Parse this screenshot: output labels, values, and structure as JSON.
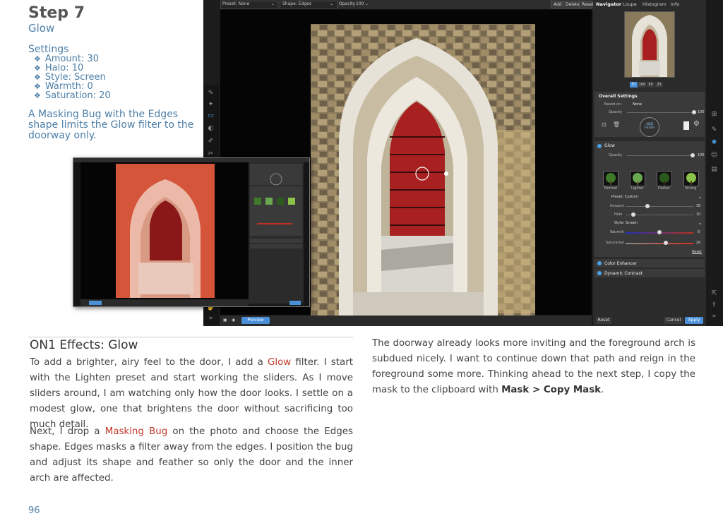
{
  "step": {
    "title": "Step 7",
    "subtitle": "Glow",
    "settings_heading": "Settings",
    "settings": [
      "Amount: 30",
      "Halo: 10",
      "Style: Screen",
      "Warmth: 0",
      "Saturation: 20"
    ],
    "caption": "A Masking Bug with the Edges shape limits the Glow filter to the doorway only."
  },
  "app": {
    "topbar": {
      "preset": "Preset: None",
      "shape": "Shape: Edges",
      "opacity_label": "Opacity",
      "opacity_value": "100",
      "add": "Add",
      "delete": "Delete",
      "reset": "Reset"
    },
    "bottombar": {
      "preview": "Preview"
    },
    "panel": {
      "tabs": [
        "Navigator",
        "Loupe",
        "Histogram",
        "Info"
      ],
      "zoom": [
        "Fit",
        "100",
        "50",
        "25"
      ],
      "overall_title": "Overall Settings",
      "based_on_label": "Based on:",
      "based_on_value": "None",
      "opacity_label": "Opacity",
      "opacity_value": "100",
      "add_filter": "ADD FILTER",
      "glow": {
        "title": "Glow",
        "opacity_label": "Opacity",
        "opacity_value": "100",
        "presets": [
          "Normal",
          "Lighter",
          "Darker",
          "Strong"
        ],
        "preset_label": "Preset: Custom",
        "amount_label": "Amount",
        "amount_value": "30",
        "amount_fraction": 0.3,
        "halo_label": "Halo",
        "halo_value": "10",
        "halo_fraction": 0.1,
        "style_label": "Style: Screen",
        "warmth_label": "Warmth",
        "warmth_value": "0",
        "warmth_fraction": 0.5,
        "saturation_label": "Saturation",
        "saturation_value": "20",
        "saturation_fraction": 0.6,
        "reset": "Reset"
      },
      "filters": [
        "Color Enhancer",
        "Dynamic Contrast"
      ],
      "reset_btn": "Reset",
      "cancel_btn": "Cancel",
      "apply_btn": "Apply"
    }
  },
  "article": {
    "heading": "ON1 Effects: Glow",
    "p1_a": "To add a brighter, airy feel to the door, I add a ",
    "p1_link": "Glow",
    "p1_b": " filter. I start with the Lighten preset and start working the sliders. As I move sliders around, I am watching only how the door looks. I settle on a modest glow, one that brightens the door without sacrificing too much detail.",
    "p2_a": "Next, I drop a ",
    "p2_link": "Masking Bug",
    "p2_b": " on the photo and choose the Edges shape. Edges masks a filter away from the edges. I position the bug and adjust its shape and feather so only the door and the inner arch are affected.",
    "p3_a": "The doorway already looks more inviting and the foreground arch is subdued nicely. I want to continue down that path and reign in the foreground some more. Thinking ahead to the next step, I copy the mask to the clipboard with ",
    "p3_bold": "Mask > Copy Mask",
    "p3_b": "."
  },
  "page_number": "96"
}
